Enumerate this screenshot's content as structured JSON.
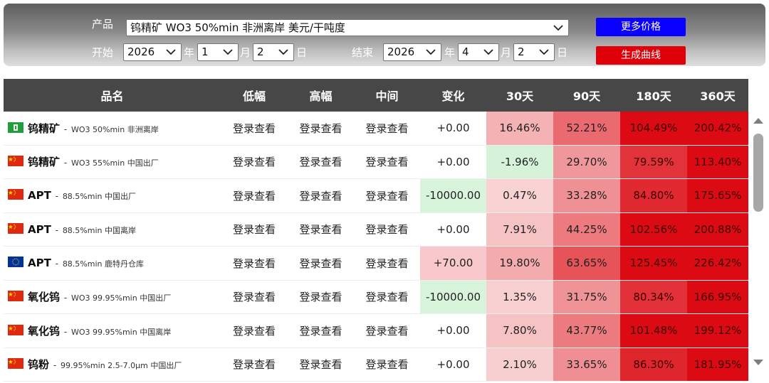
{
  "filters": {
    "product_label": "产品",
    "product_value": "钨精矿 WO3 50%min 非洲离岸 美元/干吨度",
    "start_label": "开始",
    "end_label": "结束",
    "year_unit": "年",
    "month_unit": "月",
    "day_unit": "日",
    "start": {
      "year": "2026",
      "month": "1",
      "day": "2"
    },
    "end": {
      "year": "2026",
      "month": "4",
      "day": "2"
    },
    "more_prices_button": "更多价格",
    "generate_curve_button": "生成曲线",
    "button_colors": {
      "more_prices": "#0a00ff",
      "generate_curve": "#e0000a"
    }
  },
  "table": {
    "headers": [
      "品名",
      "低幅",
      "高幅",
      "中间",
      "变化",
      "30天",
      "90天",
      "180天",
      "360天"
    ],
    "rows": [
      {
        "flag": "africa-flag-icon",
        "name": "钨精矿",
        "sep": " - ",
        "desc": "WO3 50%min 非洲离岸",
        "low": "登录查看",
        "high": "登录查看",
        "mid": "登录查看",
        "change": "+0.00",
        "d30": "16.46%",
        "d90": "52.21%",
        "d180": "104.49%",
        "d360": "200.42%"
      },
      {
        "flag": "china-flag-icon",
        "name": "钨精矿",
        "sep": " - ",
        "desc": "WO3 55%min 中国出厂",
        "low": "登录查看",
        "high": "登录查看",
        "mid": "登录查看",
        "change": "+0.00",
        "d30": "-1.96%",
        "d90": "29.70%",
        "d180": "79.59%",
        "d360": "113.40%"
      },
      {
        "flag": "china-flag-icon",
        "name": "APT",
        "sep": " - ",
        "desc": "88.5%min 中国出厂",
        "low": "登录查看",
        "high": "登录查看",
        "mid": "登录查看",
        "change": "-10000.00",
        "d30": "0.47%",
        "d90": "33.28%",
        "d180": "84.80%",
        "d360": "175.65%"
      },
      {
        "flag": "china-flag-icon",
        "name": "APT",
        "sep": " - ",
        "desc": "88.5%min 中国离岸",
        "low": "登录查看",
        "high": "登录查看",
        "mid": "登录查看",
        "change": "+0.00",
        "d30": "7.91%",
        "d90": "44.25%",
        "d180": "102.56%",
        "d360": "200.88%"
      },
      {
        "flag": "eu-flag-icon",
        "name": "APT",
        "sep": " - ",
        "desc": "88.5%min 鹿特丹仓库",
        "low": "登录查看",
        "high": "登录查看",
        "mid": "登录查看",
        "change": "+70.00",
        "d30": "19.80%",
        "d90": "63.65%",
        "d180": "125.45%",
        "d360": "226.42%"
      },
      {
        "flag": "china-flag-icon",
        "name": "氧化钨",
        "sep": " - ",
        "desc": "WO3 99.95%min 中国出厂",
        "low": "登录查看",
        "high": "登录查看",
        "mid": "登录查看",
        "change": "-10000.00",
        "d30": "1.35%",
        "d90": "31.75%",
        "d180": "80.34%",
        "d360": "166.95%"
      },
      {
        "flag": "china-flag-icon",
        "name": "氧化钨",
        "sep": " - ",
        "desc": "WO3 99.95%min 中国离岸",
        "low": "登录查看",
        "high": "登录查看",
        "mid": "登录查看",
        "change": "+0.00",
        "d30": "7.80%",
        "d90": "43.77%",
        "d180": "101.48%",
        "d360": "199.12%"
      },
      {
        "flag": "china-flag-icon",
        "name": "钨粉",
        "sep": " - ",
        "desc": "99.95%min 2.5-7.0μm 中国出厂",
        "low": "登录查看",
        "high": "登录查看",
        "mid": "登录查看",
        "change": "+0.00",
        "d30": "2.10%",
        "d90": "33.65%",
        "d180": "86.30%",
        "d360": "181.95%"
      }
    ]
  },
  "colors": {
    "header_bg": "#474747",
    "positive_change_bg": "#f8c8cc",
    "negative_change_bg": "#d8f5dc",
    "negative_percent_bg": "#d6f3da",
    "red_max": "#dc0a12"
  }
}
